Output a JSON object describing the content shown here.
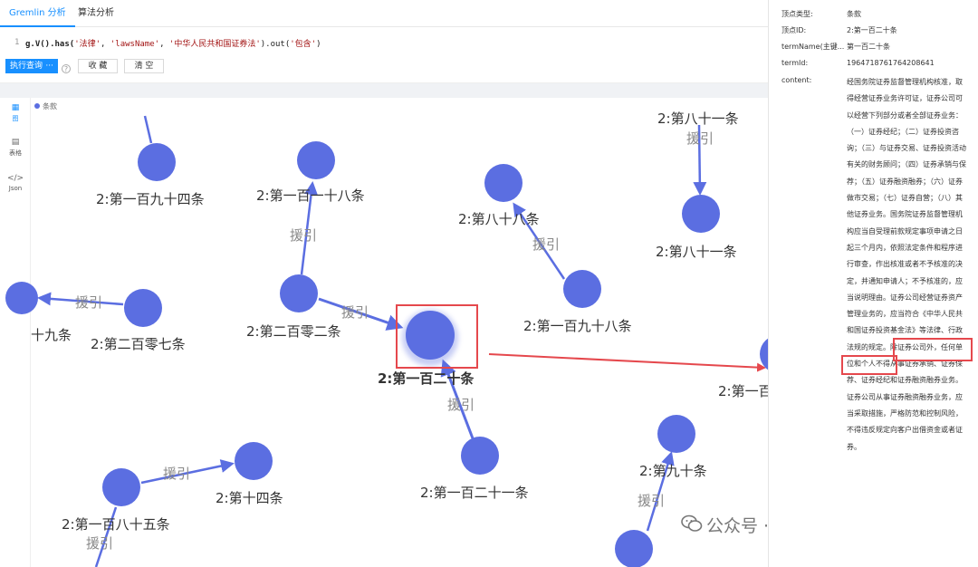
{
  "tabs": [
    {
      "label": "Gremlin 分析"
    },
    {
      "label": "算法分析"
    }
  ],
  "editor": {
    "line": "1",
    "q_prefix": "g.V().has(",
    "q_arg1": "'法律'",
    "q_arg2": "'lawsName'",
    "q_arg3": "'中华人民共和国证券法'",
    "q_mid": ").out(",
    "q_arg4": "'包含'",
    "q_suffix": ")"
  },
  "toolbar": {
    "run_label": "执行查询",
    "more_label": "···",
    "help": "?",
    "save_label": "收 藏",
    "clear_label": "清 空"
  },
  "side_nav": [
    {
      "icon": "▦",
      "label": "图"
    },
    {
      "icon": "▤",
      "label": "表格"
    },
    {
      "icon": "</>",
      "label": "Json"
    }
  ],
  "legend": {
    "label": "条款",
    "color": "#5b6ee1"
  },
  "graph": {
    "node_color": "#5b6ee1",
    "edge_color": "#5b6ee1",
    "highlight_color": "#e5484d",
    "nodes": [
      {
        "label": "2:第一百九十四条"
      },
      {
        "label": "2:第一百一十八条"
      },
      {
        "label": "2:第八十八条"
      },
      {
        "label": "2:第八十一条"
      },
      {
        "label": "2:第二百零二条"
      },
      {
        "label": "2:第二百零七条"
      },
      {
        "label": "十九条"
      },
      {
        "label": "2:第一百九十八条"
      },
      {
        "label": "2:第一百二十条"
      },
      {
        "label": "2:第一百二十一条"
      },
      {
        "label": "2:第十四条"
      },
      {
        "label": "2:第一百八十五条"
      },
      {
        "label": "2:第九十条"
      },
      {
        "label": "2:第一百"
      },
      {
        "label": "2:第八十一条"
      }
    ],
    "edge_label": "援引"
  },
  "detail": {
    "rows": [
      {
        "k": "顶点类型:",
        "v": "条款"
      },
      {
        "k": "顶点ID:",
        "v": "2:第一百二十条"
      },
      {
        "k": "termName(主键...",
        "v": "第一百二十条"
      },
      {
        "k": "termId:",
        "v": "1964718761764208641"
      },
      {
        "k": "content:",
        "v": ""
      }
    ],
    "content": "经国务院证券监督管理机构核准，取得经营证券业务许可证，证券公司可以经营下列部分或者全部证券业务：（一）证券经纪；（二）证券投资咨询；（三）与证券交易、证券投资活动有关的财务顾问；（四）证券承销与保荐；（五）证券融资融券；（六）证券做市交易；（七）证券自营；（八）其他证券业务。国务院证券监督管理机构应当自受理前款规定事项申请之日起三个月内，依照法定条件和程序进行审查，作出核准或者不予核准的决定，并通知申请人；不予核准的，应当说明理由。证券公司经营证券资产管理业务的，应当符合《中华人民共和国证券投资基金法》等法律、行政法规的规定。除证券公司外，任何单位和个人不得从事证券承销、证券保荐、证券经纪和证券融资融券业务。证券公司从事证券融资融券业务，应当采取措施，严格防范和控制风险，不得违反规定向客户出借资金或者证券。"
  },
  "watermark": {
    "text": "公众号 · 码猿小站"
  }
}
